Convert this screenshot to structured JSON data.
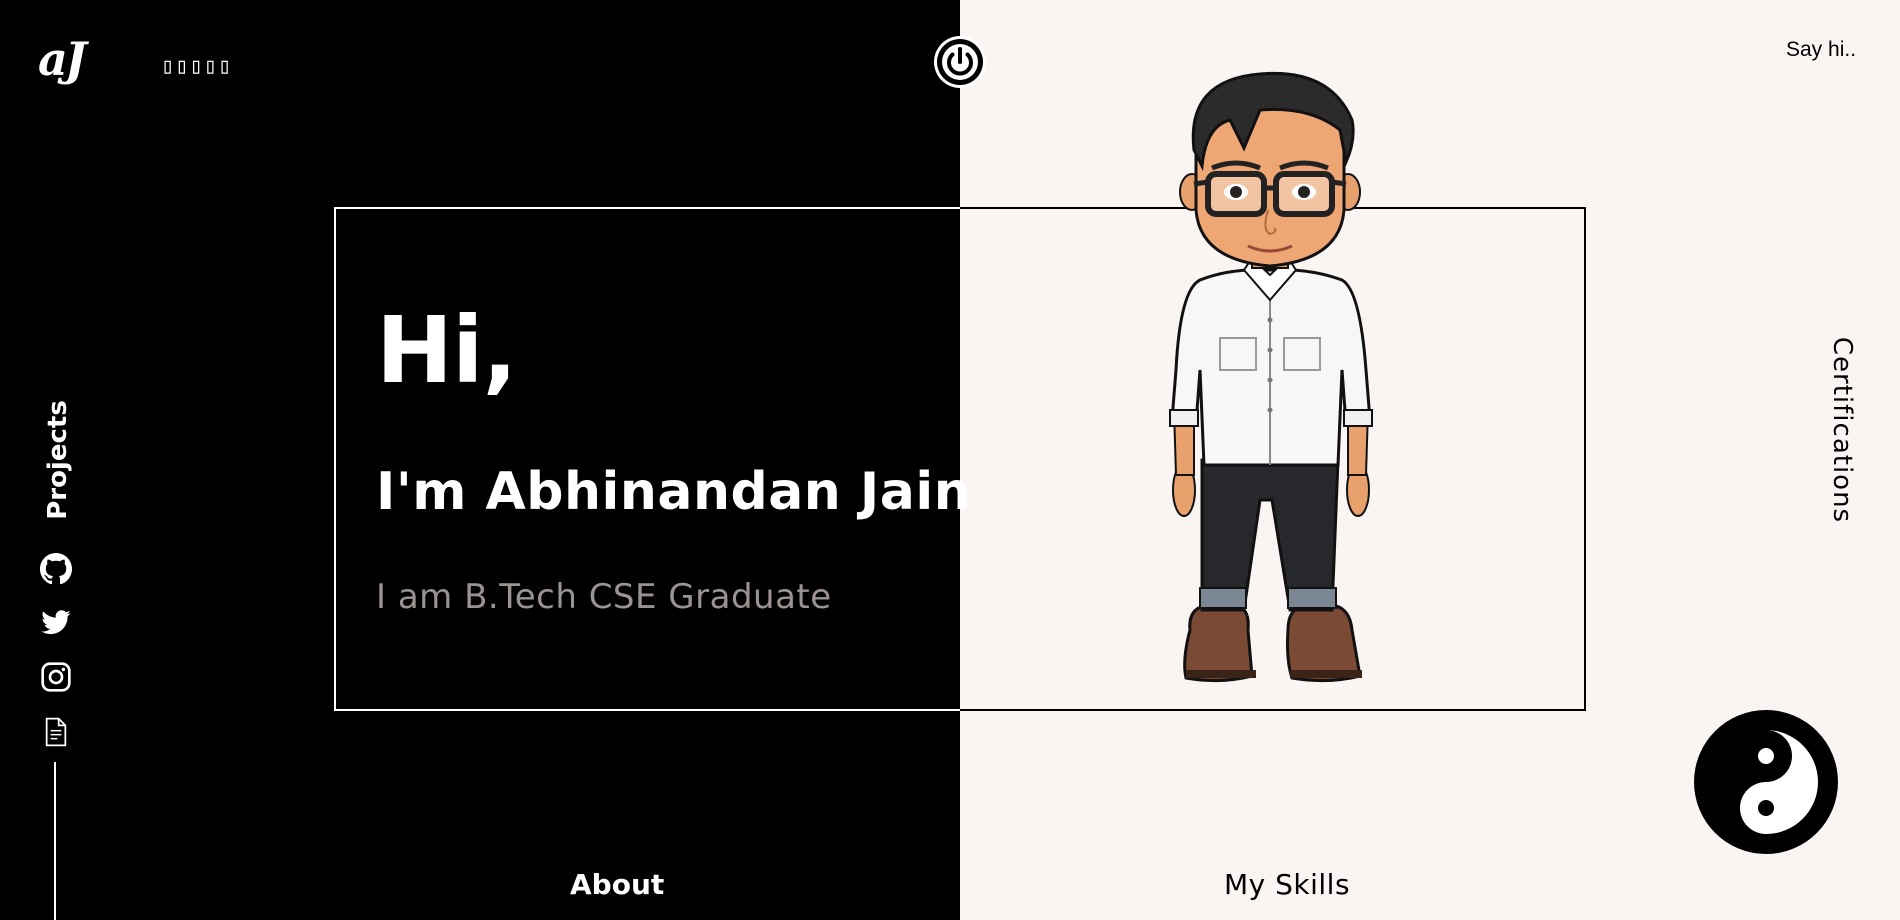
{
  "header": {
    "logo_text": "aJ",
    "unrendered_glyphs": "▯▯▯▯▯",
    "power_icon": "power-icon",
    "say_hi_label": "Say hi.."
  },
  "nav": {
    "projects_label": "Projects",
    "certifications_label": "Certifications",
    "about_label": "About",
    "skills_label": "My Skills"
  },
  "social": {
    "icons": [
      "github-icon",
      "twitter-icon",
      "instagram-icon",
      "document-icon"
    ]
  },
  "hero": {
    "greeting": "Hi,",
    "name_line": "I'm Abhinandan Jain",
    "tagline": "I am B.Tech CSE Graduate"
  },
  "theme": {
    "dark_bg": "#000000",
    "light_bg": "#faf5f3",
    "muted_text": "#9a9391"
  }
}
